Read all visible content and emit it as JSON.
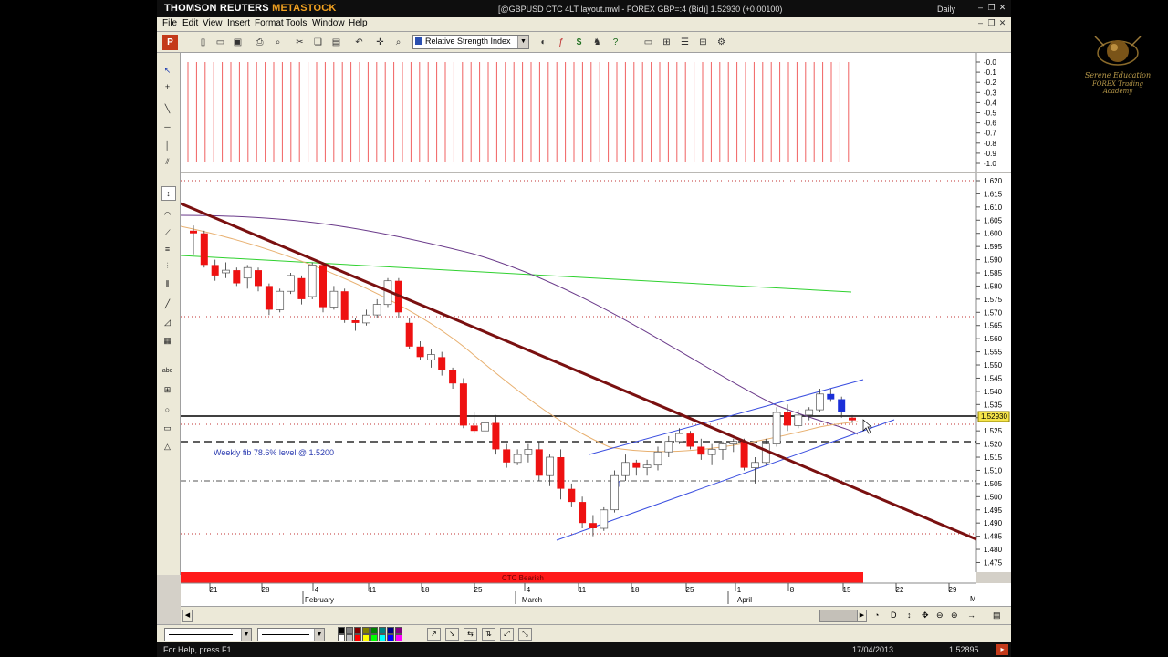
{
  "app": {
    "brand": "THOMSON REUTERS",
    "brand_accent": "METASTOCK",
    "document_title": "[@GBPUSD CTC 4LT layout.mwl - FOREX GBP=:4 (Bid)]  1.52930 (+0.00100)",
    "period": "Daily"
  },
  "menu": [
    "File",
    "Edit",
    "View",
    "Insert",
    "Format",
    "Tools",
    "Window",
    "Help"
  ],
  "toolbar": {
    "indicator_select": "Relative Strength Index",
    "icons": [
      "new-icon",
      "open-icon",
      "save-icon",
      "print-icon",
      "zoom-icon",
      "cut-icon",
      "copy-icon",
      "paste-icon",
      "undo-icon",
      "crosshair-icon",
      "magnifier-icon",
      "indicator-icon",
      "fx-icon",
      "dollar-icon",
      "expert-icon",
      "help-icon",
      "window-icon",
      "tile-icon",
      "tile-horizontal-icon",
      "tile-vertical-icon",
      "options-icon"
    ]
  },
  "watermark": {
    "line1": "Serene Education",
    "line2": "FOREX Trading Academy"
  },
  "chart": {
    "upper_panel_axis": [
      "-0.0",
      "-0.1",
      "-0.2",
      "-0.3",
      "-0.4",
      "-0.5",
      "-0.6",
      "-0.7",
      "-0.8",
      "-0.9",
      "-1.0"
    ],
    "price_axis": [
      "1.620",
      "1.615",
      "1.610",
      "1.605",
      "1.600",
      "1.595",
      "1.590",
      "1.585",
      "1.580",
      "1.575",
      "1.570",
      "1.565",
      "1.560",
      "1.555",
      "1.550",
      "1.545",
      "1.540",
      "1.535",
      "1.530",
      "1.525",
      "1.520",
      "1.515",
      "1.510",
      "1.505",
      "1.500",
      "1.495",
      "1.490",
      "1.485",
      "1.480",
      "1.475"
    ],
    "last_price_label": "1.52930",
    "annotation": "Weekly fib 78.6% level @ 1.5200",
    "signal_bar_label": "CTC Bearish",
    "date_ticks": [
      "21",
      "28",
      "4",
      "11",
      "18",
      "25",
      "4",
      "11",
      "18",
      "25",
      "1",
      "8",
      "15",
      "22",
      "29"
    ],
    "month_labels": [
      "February",
      "March",
      "April"
    ],
    "axis_end_label": "M"
  },
  "status": {
    "help_text": "For Help, press F1",
    "date": "17/04/2013",
    "price": "1.52895"
  },
  "colors": {
    "bear_candle": "#ee1111",
    "bull_candle": "#ffffff",
    "recent_bear": "#1a2fd8",
    "trendline": "#7a1010",
    "channel": "#3b4fe0",
    "ma_long": "#2fd12f",
    "ma_mid": "#6a3a8a",
    "ma_short": "#e8b070"
  }
}
